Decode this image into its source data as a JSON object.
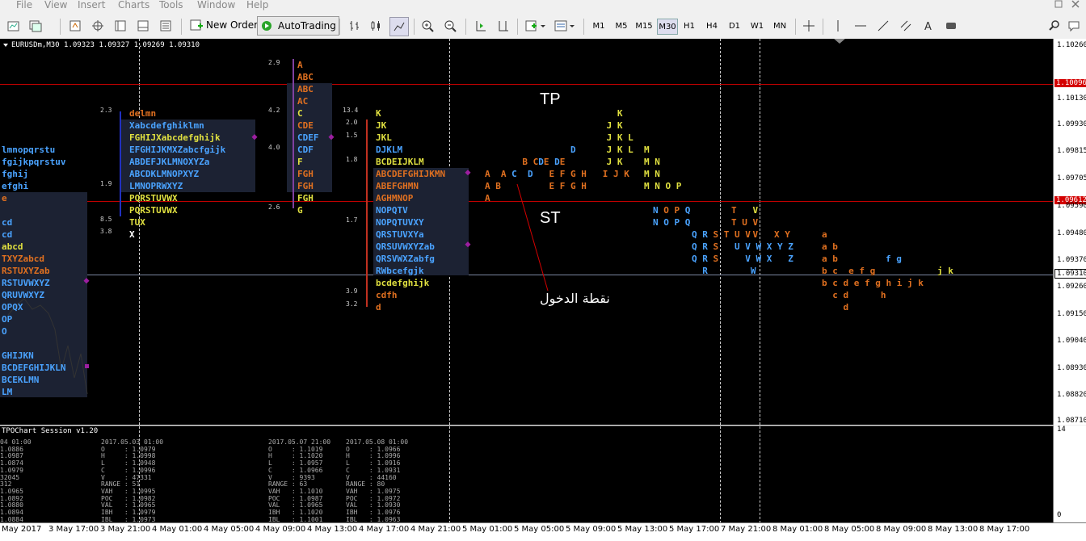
{
  "menu": [
    "File",
    "View",
    "Insert",
    "Charts",
    "Tools",
    "Window",
    "Help"
  ],
  "toolbar": {
    "new_order": "New Order",
    "autotrading": "AutoTrading",
    "timeframes": [
      "M1",
      "M5",
      "M15",
      "M30",
      "H1",
      "H4",
      "D1",
      "W1",
      "MN"
    ],
    "selected_tf": "M30"
  },
  "chart": {
    "header": "EURUSDm,M30  1.09323 1.09327 1.09269 1.09310",
    "tp_label": "TP",
    "st_label": "ST",
    "entry_label": "نقطة الدخول",
    "tp_price": "1.10096",
    "st_price": "1.09612",
    "current_price": "1.09310",
    "colors": {
      "tp_line": "#c00000",
      "st_line": "#c00000",
      "current_line": "#7a86a0"
    },
    "price_labels": [
      "1.10260",
      "1.10130",
      "1.09930",
      "1.09815",
      "1.09705",
      "1.09590",
      "1.09480",
      "1.09370",
      "1.09260",
      "1.09150",
      "1.09040",
      "1.08930",
      "1.08820",
      "1.08710"
    ],
    "tpo_numbers": [
      "2.3",
      "1.9",
      "8.5",
      "3.8",
      "2.9",
      "4.2",
      "4.0",
      "2.6",
      "13.4",
      "2.0",
      "1.5",
      "1.8",
      "1.7",
      "3.9",
      "3.2"
    ]
  },
  "indicator": {
    "title": "TPOChart Session v1.20",
    "scale_top": "14",
    "scale_bottom": "0",
    "sessions": [
      {
        "date": "04 01:00",
        "rows": [
          "1.0886",
          "1.0987",
          "1.0874",
          "1.0979",
          "32045",
          "312",
          "1.0965",
          "1.0892",
          "1.0880",
          "1.0894",
          "1.0884"
        ]
      },
      {
        "date": "2017.05.03 01:00",
        "rows": [
          "O     : 1.0979",
          "H     : 1.0998",
          "L     : 1.0948",
          "C     : 1.0996",
          "V     : 47331",
          "RANGE : 51",
          "VAH   : 1.0995",
          "POC   : 1.0982",
          "VAL   : 1.0965",
          "IBH   : 1.0979",
          "IBL   : 1.0973"
        ]
      },
      {
        "date": "2017.05.07 21:00",
        "rows": [
          "O     : 1.1019",
          "H     : 1.1020",
          "L     : 1.0957",
          "C     : 1.0966",
          "V     : 9393",
          "RANGE : 63",
          "VAH   : 1.1010",
          "POC   : 1.0987",
          "VAL   : 1.0965",
          "IBH   : 1.1020",
          "IBL   : 1.1001"
        ]
      },
      {
        "date": "2017.05.08 01:00",
        "rows": [
          "O     : 1.0966",
          "H     : 1.0996",
          "L     : 1.0916",
          "C     : 1.0931",
          "V     : 44160",
          "RANGE : 80",
          "VAH   : 1.0975",
          "POC   : 1.0972",
          "VAL   : 1.0930",
          "IBH   : 1.0976",
          "IBL   : 1.0963"
        ]
      }
    ]
  },
  "time_labels": [
    "May 2017",
    "3 May 17:00",
    "3 May 21:00",
    "4 May 01:00",
    "4 May 05:00",
    "4 May 09:00",
    "4 May 13:00",
    "4 May 17:00",
    "4 May 21:00",
    "5 May 01:00",
    "5 May 05:00",
    "5 May 09:00",
    "5 May 13:00",
    "5 May 17:00",
    "7 May 21:00",
    "8 May 01:00",
    "8 May 05:00",
    "8 May 09:00",
    "8 May 13:00",
    "8 May 17:00"
  ]
}
